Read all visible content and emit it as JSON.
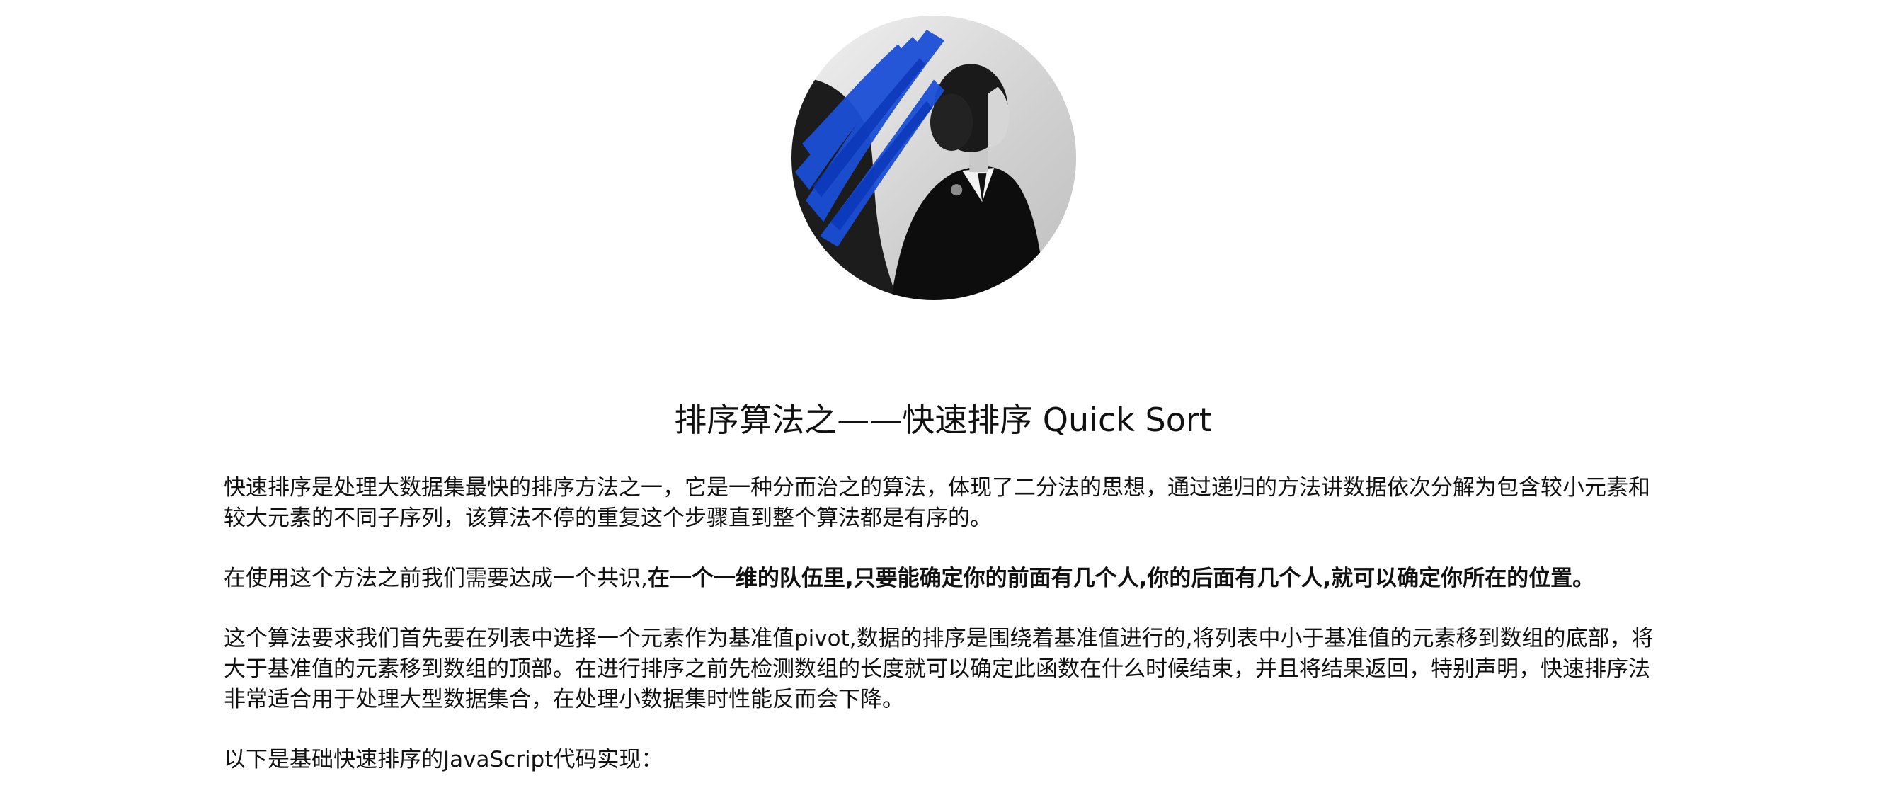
{
  "avatar": {
    "icon": "avatar-portrait-icon",
    "accent_color": "#1a4fd6"
  },
  "article": {
    "title": "排序算法之——快速排序 Quick Sort",
    "p1": "快速排序是处理大数据集最快的排序方法之一，它是一种分而治之的算法，体现了二分法的思想，通过递归的方法讲数据依次分解为包含较小元素和较大元素的不同子序列，该算法不停的重复这个步骤直到整个算法都是有序的。",
    "p2_lead": "在使用这个方法之前我们需要达成一个共识,",
    "p2_bold": "在一个一维的队伍里,只要能确定你的前面有几个人,你的后面有几个人,就可以确定你所在的位置。",
    "p3": "这个算法要求我们首先要在列表中选择一个元素作为基准值pivot,数据的排序是围绕着基准值进行的,将列表中小于基准值的元素移到数组的底部，将大于基准值的元素移到数组的顶部。在进行排序之前先检测数组的长度就可以确定此函数在什么时候结束，并且将结果返回，特别声明，快速排序法非常适合用于处理大型数据集合，在处理小数据集时性能反而会下降。",
    "p4": "以下是基础快速排序的JavaScript代码实现："
  }
}
